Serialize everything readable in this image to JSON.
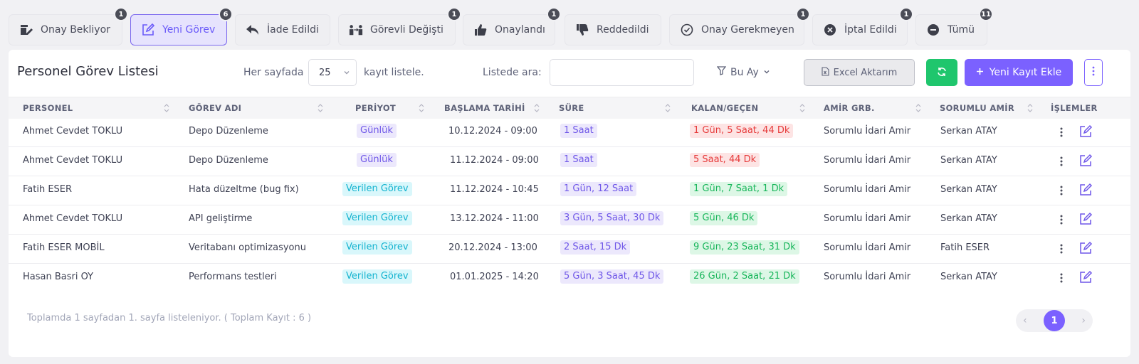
{
  "tabs": [
    {
      "label": "Onay Bekliyor",
      "count": "1",
      "icon": "approval-pending-icon"
    },
    {
      "label": "Yeni Görev",
      "count": "6",
      "icon": "edit-icon",
      "active": true
    },
    {
      "label": "İade Edildi",
      "count": "",
      "icon": "reply-icon"
    },
    {
      "label": "Görevli Değişti",
      "count": "1",
      "icon": "swap-people-icon"
    },
    {
      "label": "Onaylandı",
      "count": "1",
      "icon": "thumbs-up-icon"
    },
    {
      "label": "Reddedildi",
      "count": "",
      "icon": "thumbs-down-icon"
    },
    {
      "label": "Onay Gerekmeyen",
      "count": "1",
      "icon": "check-circle-icon"
    },
    {
      "label": "İptal Edildi",
      "count": "1",
      "icon": "x-circle-icon"
    },
    {
      "label": "Tümü",
      "count": "11",
      "icon": "minus-circle-icon"
    }
  ],
  "toolbar": {
    "title": "Personel Görev Listesi",
    "per_page_label": "Her sayfada",
    "per_page_value": "25",
    "per_page_suffix": "kayıt listele.",
    "search_label": "Listede ara:",
    "search_value": "",
    "filter_label": "Bu Ay",
    "excel_label": "Excel Aktarım",
    "new_label": "Yeni Kayıt Ekle"
  },
  "table": {
    "headers": [
      "PERSONEL",
      "GÖREV ADI",
      "PERİYOT",
      "BAŞLAMA TARİHİ",
      "SÜRE",
      "KALAN/GEÇEN",
      "AMİR GRB.",
      "SORUMLU AMİR",
      "İŞLEMLER"
    ],
    "rows": [
      {
        "personel": "Ahmet Cevdet TOKLU",
        "gorev": "Depo Düzenleme",
        "periyot": "Günlük",
        "periyot_type": "purple",
        "baslama": "10.12.2024 - 09:00",
        "sure": "1 Saat",
        "kalan": "1 Gün, 5 Saat, 44 Dk",
        "kalan_type": "red",
        "amir_grb": "Sorumlu İdari Amir",
        "sorumlu": "Serkan ATAY"
      },
      {
        "personel": "Ahmet Cevdet TOKLU",
        "gorev": "Depo Düzenleme",
        "periyot": "Günlük",
        "periyot_type": "purple",
        "baslama": "11.12.2024 - 09:00",
        "sure": "1 Saat",
        "kalan": "5 Saat, 44 Dk",
        "kalan_type": "red",
        "amir_grb": "Sorumlu İdari Amir",
        "sorumlu": "Serkan ATAY"
      },
      {
        "personel": "Fatih ESER",
        "gorev": "Hata düzeltme (bug fix)",
        "periyot": "Verilen Görev",
        "periyot_type": "cyan",
        "baslama": "11.12.2024 - 10:45",
        "sure": "1 Gün, 12 Saat",
        "kalan": "1 Gün, 7 Saat, 1 Dk",
        "kalan_type": "green",
        "amir_grb": "Sorumlu İdari Amir",
        "sorumlu": "Serkan ATAY"
      },
      {
        "personel": "Ahmet Cevdet TOKLU",
        "gorev": "API geliştirme",
        "periyot": "Verilen Görev",
        "periyot_type": "cyan",
        "baslama": "13.12.2024 - 11:00",
        "sure": "3 Gün, 5 Saat, 30 Dk",
        "kalan": "5 Gün, 46 Dk",
        "kalan_type": "green",
        "amir_grb": "Sorumlu İdari Amir",
        "sorumlu": "Serkan ATAY"
      },
      {
        "personel": "Fatih ESER MOBİL",
        "gorev": "Veritabanı optimizasyonu",
        "periyot": "Verilen Görev",
        "periyot_type": "cyan",
        "baslama": "20.12.2024 - 13:00",
        "sure": "2 Saat, 15 Dk",
        "kalan": "9 Gün, 23 Saat, 31 Dk",
        "kalan_type": "green",
        "amir_grb": "Sorumlu İdari Amir",
        "sorumlu": "Fatih ESER"
      },
      {
        "personel": "Hasan Basri OY",
        "gorev": "Performans testleri",
        "periyot": "Verilen Görev",
        "periyot_type": "cyan",
        "baslama": "01.01.2025 - 14:20",
        "sure": "5 Gün, 3 Saat, 45 Dk",
        "kalan": "26 Gün, 2 Saat, 21 Dk",
        "kalan_type": "green",
        "amir_grb": "Sorumlu İdari Amir",
        "sorumlu": "Serkan ATAY"
      }
    ]
  },
  "footer": {
    "summary": "Toplamda 1 sayfadan 1. sayfa listeleniyor. ( Toplam Kayıt : 6 )",
    "current_page": "1",
    "prev": "‹",
    "next": "›"
  },
  "colors": {
    "accent": "#7b61ff",
    "refresh": "#1fc66d"
  }
}
